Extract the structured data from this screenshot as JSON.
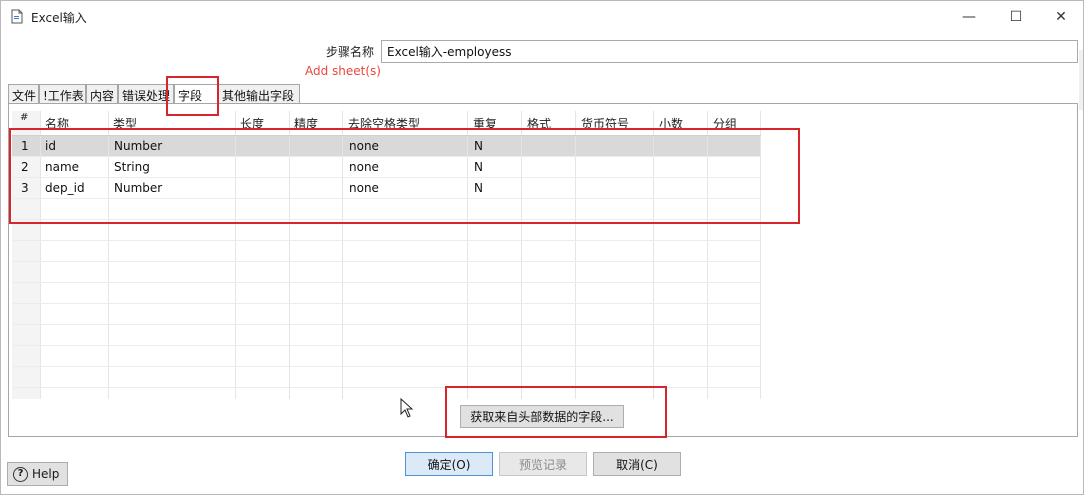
{
  "window": {
    "title": "Excel输入",
    "controls": {
      "minimize": "—",
      "maximize": "☐",
      "close": "✕"
    }
  },
  "step": {
    "label": "步骤名称",
    "value": "Excel输入-employess"
  },
  "add_sheet_link": "Add sheet(s)",
  "tabs": [
    {
      "label": "文件"
    },
    {
      "label": "!工作表"
    },
    {
      "label": "内容"
    },
    {
      "label": "错误处理"
    },
    {
      "label": "字段",
      "active": true
    },
    {
      "label": "其他输出字段"
    }
  ],
  "table": {
    "columns": [
      "#",
      "名称",
      "类型",
      "长度",
      "精度",
      "去除空格类型",
      "重复",
      "格式",
      "货币符号",
      "小数",
      "分组"
    ],
    "rows": [
      [
        "1",
        "id",
        "Number",
        "",
        "",
        "none",
        "N",
        "",
        "",
        "",
        ""
      ],
      [
        "2",
        "name",
        "String",
        "",
        "",
        "none",
        "N",
        "",
        "",
        "",
        ""
      ],
      [
        "3",
        "dep_id",
        "Number",
        "",
        "",
        "none",
        "N",
        "",
        "",
        "",
        ""
      ]
    ]
  },
  "get_fields_button": "获取来自头部数据的字段...",
  "buttons": {
    "ok": "确定(O)",
    "preview": "预览记录",
    "cancel": "取消(C)",
    "help": "Help"
  },
  "colors": {
    "highlight_red": "#d7252b",
    "add_sheet_red": "#e8483a",
    "selected_row": "#d9d9d9",
    "primary_border": "#4d8fd8"
  }
}
